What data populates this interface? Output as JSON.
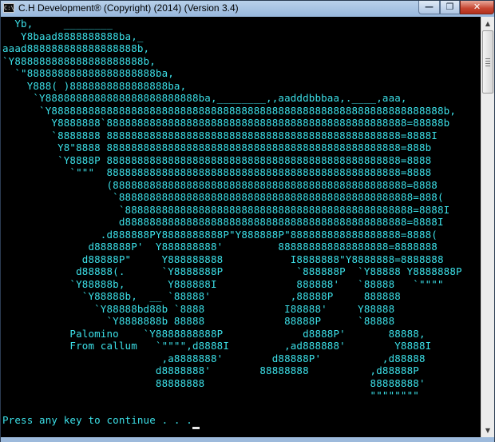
{
  "window": {
    "title": "C.H Development® (Copyright) (2014) (Version 3.4)",
    "icon_label": "C:\\",
    "buttons": {
      "minimize": "—",
      "maximize": "❐",
      "close": "✕"
    }
  },
  "console": {
    "text_color": "#3ce0e8",
    "background": "#000000",
    "art_lines": [
      "  Yb,     ________",
      "   Y8baad8888888888ba,_",
      "aaad888888888888888888b,",
      "`Y888888888888888888888b,",
      "  `\"888888888888888888888ba,",
      "    Y888( )8888888888888888ba,",
      "     `Y8888888888888888888888888ba,________,,aadddbbbaa,.____,aaa,",
      "      `Y8888888888888888888888888888888888888888888888888888888888888888b,",
      "        Y8888888`8888888888888888888888888888888888888888888888888=88888b",
      "        `8888888 888888888888888888888888888888888888888888888888=8888I",
      "         Y8\"8888 888888888888888888888888888888888888888888888888=888b",
      "         `Y8888P 888888888888888888888888888888888888888888888888=8888",
      "           `\"\"\"  888888888888888888888888888888888888888888888888=8888",
      "                 (888888888888888888888888888888888888888888888888=8888",
      "                  `888888888888888888888888888888888888888888888888=888(",
      "                   `88888888888888888888888888888888888888888888888=8888I",
      "                   d8888888888888888888888888888888888888888888888=8888I",
      "                .d888888PY8888888888P\"Y888888P\"888888888888888888=8888(",
      "              d888888P'  Y888888888'         888888888888888888=8888888",
      "             d88888P\"     Y888888888           I8888888\"Y8888888=8888888",
      "            d88888(.      `Y8888888P            `888888P  `Y88888 Y8888888P",
      "           `Y88888b,       Y888888I             888888'   `88888   `\"\"\"\"",
      "             `Y88888b,  __ `88888'             ,88888P     888888",
      "               `Y88888bd88b `8888             I88888'     Y88888",
      "                 `Y8888888b 88888             88888P      `88888",
      "           Palomino    `Y8888888888P             d8888P'       88888,",
      "           From callum   `\"\"\"\",d8888I         ,ad888888'        Y8888I",
      "                          ,a8888888'        d88888P'          ,d88888",
      "                         d8888888'        88888888          ,d88888P",
      "                         88888888                           88888888'",
      "                                                            \"\"\"\"\"\"\"\""
    ],
    "prompt": "Press any key to continue . . . "
  }
}
